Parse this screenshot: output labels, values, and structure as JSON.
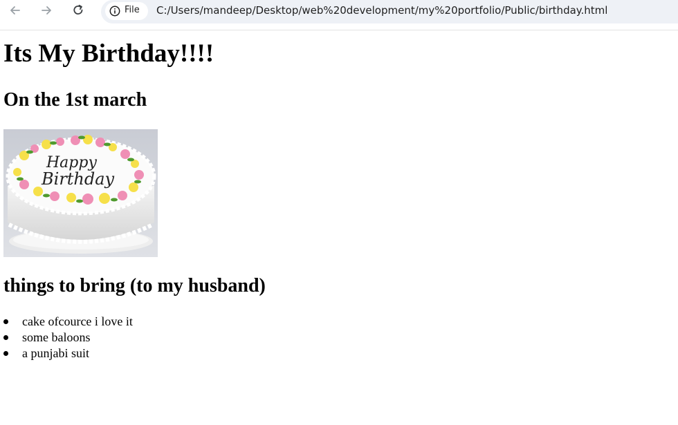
{
  "browser": {
    "chip_label": "File",
    "url": "C:/Users/mandeep/Desktop/web%20development/my%20portfolio/Public/birthday.html"
  },
  "page": {
    "heading": "Its My Birthday!!!!",
    "date_heading": "On the 1st march",
    "image_text": [
      "Happy",
      "Birthday"
    ],
    "list_heading": "things to bring (to my husband)",
    "items": [
      "cake ofcource i love it",
      "some baloons",
      "a punjabi suit"
    ]
  },
  "colors": {
    "toolbar_bg": "#ffffff",
    "omnibox_bg": "#eef1f6",
    "icon_color": "#5f6368"
  }
}
